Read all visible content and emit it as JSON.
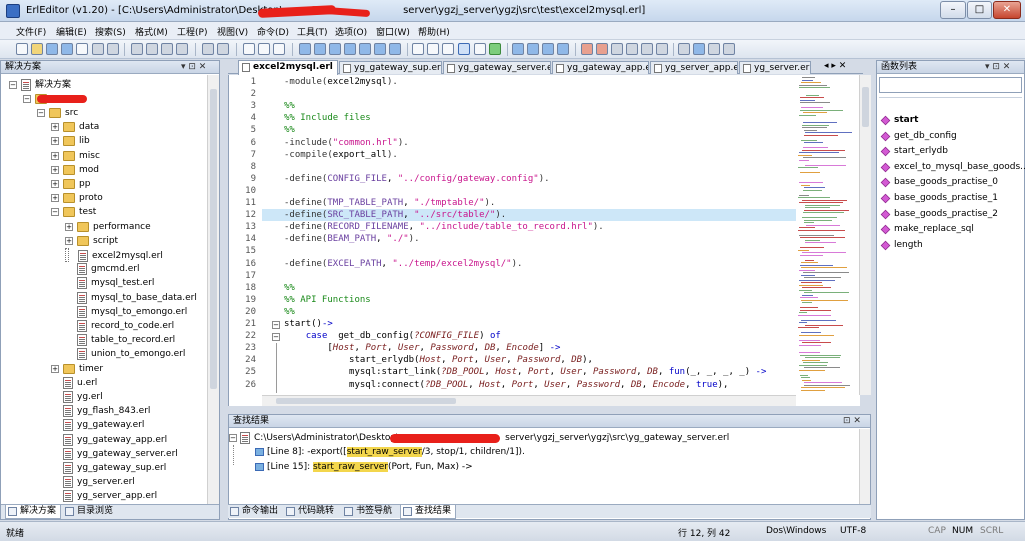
{
  "window": {
    "app": "ErlEditor (v1.20)",
    "path_prefix": "[C:\\Users\\Administrator\\Desktop\\",
    "path_suffix": "server\\ygzj_server\\ygzj\\src\\test\\excel2mysql.erl]",
    "minimize": "–",
    "maximize": "□",
    "close": "✕"
  },
  "menu": [
    "文件(F)",
    "编辑(E)",
    "搜索(S)",
    "格式(M)",
    "工程(P)",
    "视图(V)",
    "命令(D)",
    "工具(T)",
    "选项(O)",
    "窗口(W)",
    "帮助(H)"
  ],
  "solution": {
    "title": "解决方案",
    "pin": "▾ ⊡ ✕",
    "root": "解决方案",
    "items": [
      {
        "label": "src",
        "kind": "folder"
      },
      {
        "label": "data",
        "kind": "folder"
      },
      {
        "label": "lib",
        "kind": "folder"
      },
      {
        "label": "misc",
        "kind": "folder"
      },
      {
        "label": "mod",
        "kind": "folder"
      },
      {
        "label": "pp",
        "kind": "folder"
      },
      {
        "label": "proto",
        "kind": "folder"
      },
      {
        "label": "test",
        "kind": "folder"
      },
      {
        "label": "performance",
        "kind": "folder"
      },
      {
        "label": "script",
        "kind": "folder"
      },
      {
        "label": "excel2mysql.erl",
        "kind": "file"
      },
      {
        "label": "gmcmd.erl",
        "kind": "file"
      },
      {
        "label": "mysql_test.erl",
        "kind": "file"
      },
      {
        "label": "mysql_to_base_data.erl",
        "kind": "file"
      },
      {
        "label": "mysql_to_emongo.erl",
        "kind": "file"
      },
      {
        "label": "record_to_code.erl",
        "kind": "file"
      },
      {
        "label": "table_to_record.erl",
        "kind": "file"
      },
      {
        "label": "union_to_emongo.erl",
        "kind": "file"
      },
      {
        "label": "timer",
        "kind": "folder"
      },
      {
        "label": "u.erl",
        "kind": "file"
      },
      {
        "label": "yg.erl",
        "kind": "file"
      },
      {
        "label": "yg_flash_843.erl",
        "kind": "file"
      },
      {
        "label": "yg_gateway.erl",
        "kind": "file"
      },
      {
        "label": "yg_gateway_app.erl",
        "kind": "file"
      },
      {
        "label": "yg_gateway_server.erl",
        "kind": "file"
      },
      {
        "label": "yg_gateway_sup.erl",
        "kind": "file"
      },
      {
        "label": "yg_server.erl",
        "kind": "file"
      },
      {
        "label": "yg_server_app.erl",
        "kind": "file"
      }
    ],
    "bottom_tabs": [
      "解决方案",
      "目录浏览"
    ]
  },
  "tabs": [
    "excel2mysql.erl",
    "yg_gateway_sup.erl",
    "yg_gateway_server.erl",
    "yg_gateway_app.erl",
    "yg_server_app.erl",
    "yg_server.erl"
  ],
  "tab_nav": "◂ ▸ ✕",
  "code_lines": [
    {
      "n": "1",
      "html": "<span class='atom'>-module(</span><span class='fn'>excel2mysql</span><span class='atom'>).</span>"
    },
    {
      "n": "2",
      "html": ""
    },
    {
      "n": "3",
      "html": "<span class='cm'>%%</span>"
    },
    {
      "n": "4",
      "html": "<span class='cm'>%% Include files</span>"
    },
    {
      "n": "5",
      "html": "<span class='cm'>%%</span>"
    },
    {
      "n": "6",
      "html": "<span class='atom'>-include(</span><span class='st'>\"common.hrl\"</span><span class='atom'>).</span>"
    },
    {
      "n": "7",
      "html": "<span class='atom'>-compile(</span>export_all<span class='atom'>).</span>"
    },
    {
      "n": "8",
      "html": ""
    },
    {
      "n": "9",
      "html": "<span class='atom'>-define(</span><span class='mac'>CONFIG_FILE</span>, <span class='st'>\"../config/gateway.config\"</span><span class='atom'>).</span>"
    },
    {
      "n": "10",
      "html": ""
    },
    {
      "n": "11",
      "html": "<span class='atom'>-define(</span><span class='mac'>TMP_TABLE_PATH</span>, <span class='st'>\"./tmptable/\"</span><span class='atom'>).</span>"
    },
    {
      "n": "12",
      "html": "<span class='atom'>-define(</span><span class='mac'>SRC_TABLE_PATH</span>, <span class='st'>\"../src/table/\"</span><span class='atom'>).</span>"
    },
    {
      "n": "13",
      "html": "<span class='atom'>-define(</span><span class='mac'>RECORD_FILENAME</span>, <span class='st'>\"../include/table_to_record.hrl\"</span><span class='atom'>).</span>"
    },
    {
      "n": "14",
      "html": "<span class='atom'>-define(</span><span class='mac'>BEAM_PATH</span>, <span class='st'>\"./\"</span><span class='atom'>).</span>"
    },
    {
      "n": "15",
      "html": ""
    },
    {
      "n": "16",
      "html": "<span class='atom'>-define(</span><span class='mac'>EXCEL_PATH</span>, <span class='st'>\"../temp/excel2mysql/\"</span><span class='atom'>).</span>"
    },
    {
      "n": "17",
      "html": ""
    },
    {
      "n": "18",
      "html": "<span class='cm'>%%</span>"
    },
    {
      "n": "19",
      "html": "<span class='cm'>%% API Functions</span>"
    },
    {
      "n": "20",
      "html": "<span class='cm'>%%</span>"
    },
    {
      "n": "21",
      "html": "<span class='fn'>start</span>()<span class='kw'>-></span>"
    },
    {
      "n": "22",
      "html": "    <span class='kw'>case</span>  get_db_config(<span class='var'>?CONFIG_FILE</span>) <span class='kw'>of</span>"
    },
    {
      "n": "23",
      "html": "        [<span class='var'>Host</span>, <span class='var'>Port</span>, <span class='var'>User</span>, <span class='var'>Password</span>, <span class='var'>DB</span>, <span class='var'>Encode</span>] <span class='kw'>-></span>"
    },
    {
      "n": "24",
      "html": "            start_erlydb(<span class='var'>Host</span>, <span class='var'>Port</span>, <span class='var'>User</span>, <span class='var'>Password</span>, <span class='var'>DB</span>),"
    },
    {
      "n": "25",
      "html": "            mysql:start_link(<span class='var'>?DB_POOL</span>, <span class='var'>Host</span>, <span class='var'>Port</span>, <span class='var'>User</span>, <span class='var'>Password</span>, <span class='var'>DB</span>, <span class='kw'>fun</span>(_, _, _, _) <span class='kw'>-></span>"
    },
    {
      "n": "26",
      "html": "            mysql:connect(<span class='var'>?DB_POOL</span>, <span class='var'>Host</span>, <span class='var'>Port</span>, <span class='var'>User</span>, <span class='var'>Password</span>, <span class='var'>DB</span>, <span class='var'>Encode</span>, <span class='kw'>true</span>),"
    }
  ],
  "functions": {
    "title": "函数列表",
    "pin": "▾ ⊡ ✕",
    "items": [
      "start",
      "get_db_config",
      "start_erlydb",
      "excel_to_mysql_base_goods...",
      "base_goods_practise_0",
      "base_goods_practise_1",
      "base_goods_practise_2",
      "make_replace_sql",
      "length"
    ]
  },
  "find": {
    "title": "查找结果",
    "pin": "⊡ ✕",
    "path_prefix": "C:\\Users\\Administrator\\Desktop\\",
    "path_suffix": "server\\ygzj_server\\ygzj\\src\\yg_gateway_server.erl",
    "results": [
      {
        "line": "[Line 8]:",
        "before": "-export([",
        "match": "start_raw_server",
        "after": "/3, stop/1, children/1])."
      },
      {
        "line": "[Line 15]:",
        "before": "",
        "match": "start_raw_server",
        "after": "(Port, Fun, Max) ->"
      }
    ],
    "tabs": [
      "命令输出",
      "代码跳转",
      "书签导航",
      "查找结果"
    ]
  },
  "status": {
    "ready": "就绪",
    "position": "行 12, 列 42",
    "eol": "Dos\\Windows",
    "encoding": "UTF-8",
    "cap": "CAP",
    "num": "NUM",
    "scrl": "SCRL"
  }
}
